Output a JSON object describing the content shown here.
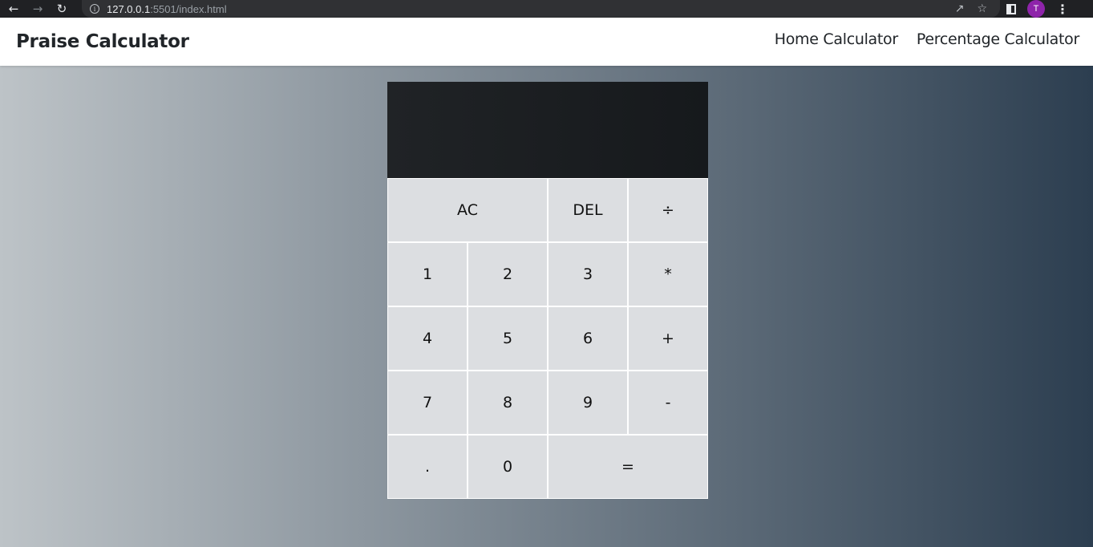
{
  "browser": {
    "url_host": "127.0.0.1",
    "url_rest": ":5501/index.html",
    "profile_initial": "T"
  },
  "navbar": {
    "brand": "Praise Calculator",
    "links": [
      "Home Calculator",
      "Percentage Calculator"
    ]
  },
  "calculator": {
    "previous_operand": "",
    "current_operand": "",
    "keys": {
      "ac": "AC",
      "del": "DEL",
      "divide": "÷",
      "one": "1",
      "two": "2",
      "three": "3",
      "multiply": "*",
      "four": "4",
      "five": "5",
      "six": "6",
      "plus": "+",
      "seven": "7",
      "eight": "8",
      "nine": "9",
      "minus": "-",
      "dot": ".",
      "zero": "0",
      "equals": "="
    }
  }
}
